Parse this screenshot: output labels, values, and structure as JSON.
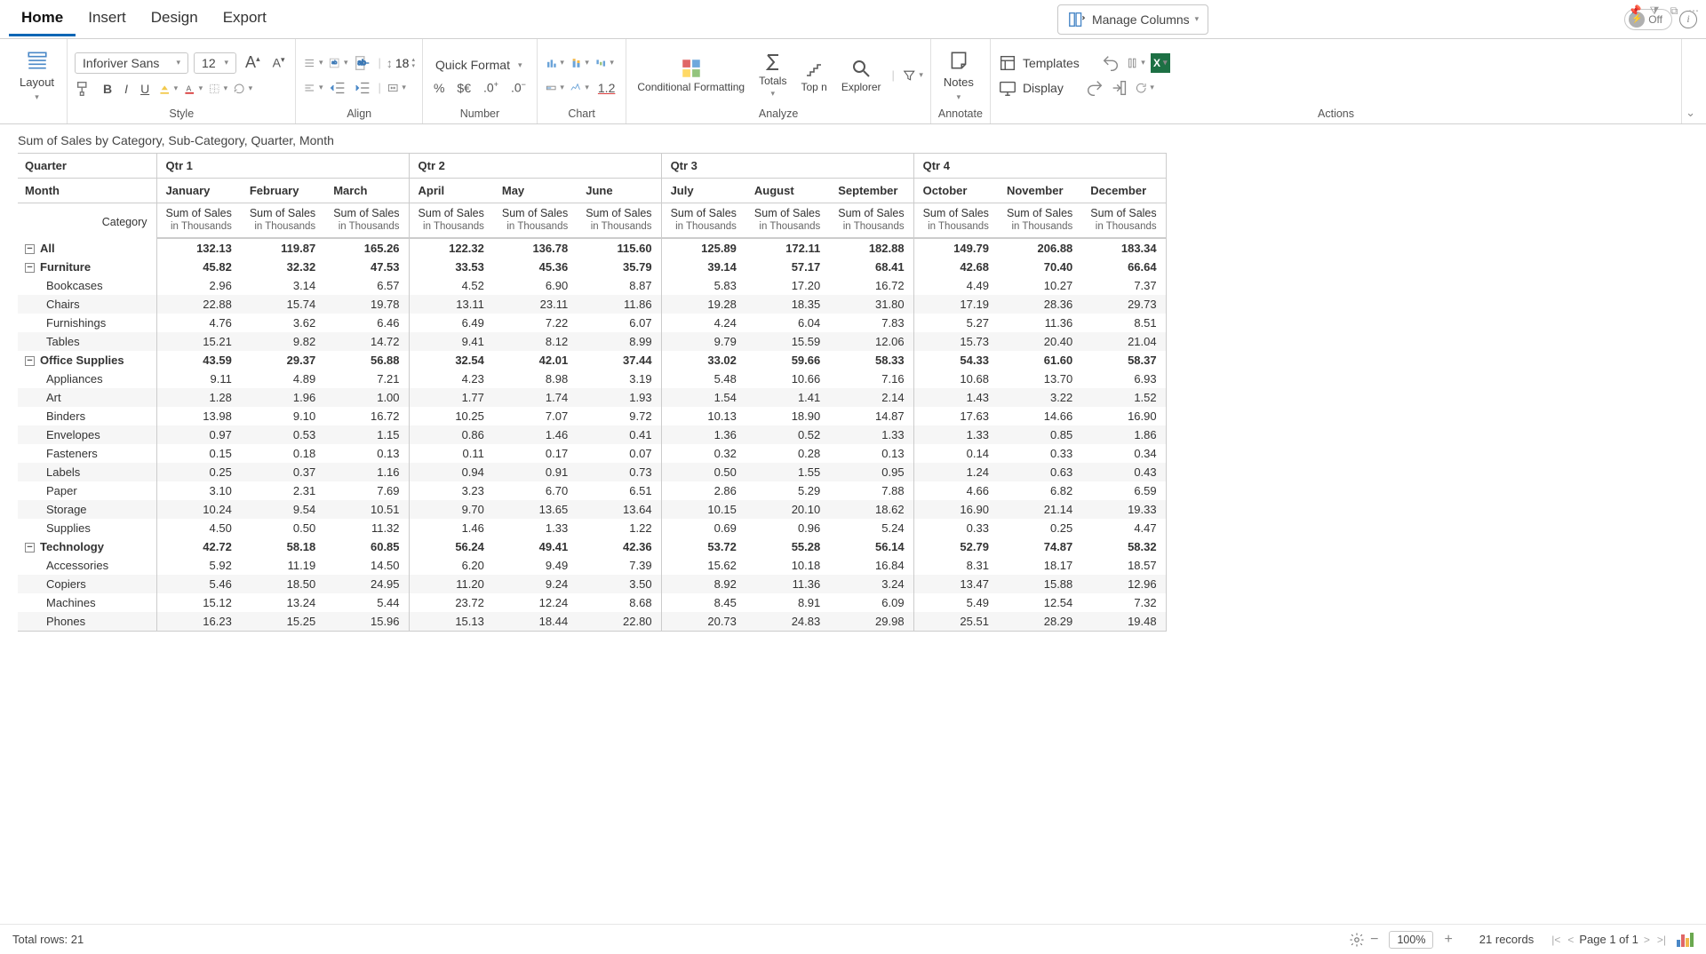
{
  "tabs": {
    "home": "Home",
    "insert": "Insert",
    "design": "Design",
    "export": "Export"
  },
  "topbar": {
    "manage_columns": "Manage Columns",
    "off": "Off"
  },
  "ribbon": {
    "layout": "Layout",
    "font_name": "Inforiver Sans",
    "font_size": "12",
    "indent_val": "18",
    "quick_format": "Quick Format",
    "cond_fmt": "Conditional Formatting",
    "totals": "Totals",
    "topn": "Top n",
    "explorer": "Explorer",
    "notes": "Notes",
    "templates": "Templates",
    "display": "Display",
    "twelve": "1.2",
    "groups": {
      "style": "Style",
      "align": "Align",
      "number": "Number",
      "chart": "Chart",
      "analyze": "Analyze",
      "annotate": "Annotate",
      "actions": "Actions"
    }
  },
  "title": "Sum of Sales by Category, Sub-Category, Quarter, Month",
  "headers": {
    "quarter": "Quarter",
    "month": "Month",
    "category": "Category",
    "quarters": [
      "Qtr 1",
      "Qtr 2",
      "Qtr 3",
      "Qtr 4"
    ],
    "months": [
      "January",
      "February",
      "March",
      "April",
      "May",
      "June",
      "July",
      "August",
      "September",
      "October",
      "November",
      "December"
    ],
    "measure": "Sum of Sales",
    "unit": "in Thousands"
  },
  "status": {
    "total_rows": "Total rows: 21",
    "zoom": "100%",
    "records": "21 records",
    "page": "Page 1 of 1"
  },
  "rows": [
    {
      "label": "All",
      "bold": true,
      "exp": true,
      "v": [
        "132.13",
        "119.87",
        "165.26",
        "122.32",
        "136.78",
        "115.60",
        "125.89",
        "172.11",
        "182.88",
        "149.79",
        "206.88",
        "183.34"
      ]
    },
    {
      "label": "Furniture",
      "bold": true,
      "exp": true,
      "v": [
        "45.82",
        "32.32",
        "47.53",
        "33.53",
        "45.36",
        "35.79",
        "39.14",
        "57.17",
        "68.41",
        "42.68",
        "70.40",
        "66.64"
      ]
    },
    {
      "label": "Bookcases",
      "indent": true,
      "v": [
        "2.96",
        "3.14",
        "6.57",
        "4.52",
        "6.90",
        "8.87",
        "5.83",
        "17.20",
        "16.72",
        "4.49",
        "10.27",
        "7.37"
      ]
    },
    {
      "label": "Chairs",
      "indent": true,
      "v": [
        "22.88",
        "15.74",
        "19.78",
        "13.11",
        "23.11",
        "11.86",
        "19.28",
        "18.35",
        "31.80",
        "17.19",
        "28.36",
        "29.73"
      ]
    },
    {
      "label": "Furnishings",
      "indent": true,
      "v": [
        "4.76",
        "3.62",
        "6.46",
        "6.49",
        "7.22",
        "6.07",
        "4.24",
        "6.04",
        "7.83",
        "5.27",
        "11.36",
        "8.51"
      ]
    },
    {
      "label": "Tables",
      "indent": true,
      "v": [
        "15.21",
        "9.82",
        "14.72",
        "9.41",
        "8.12",
        "8.99",
        "9.79",
        "15.59",
        "12.06",
        "15.73",
        "20.40",
        "21.04"
      ]
    },
    {
      "label": "Office Supplies",
      "bold": true,
      "exp": true,
      "v": [
        "43.59",
        "29.37",
        "56.88",
        "32.54",
        "42.01",
        "37.44",
        "33.02",
        "59.66",
        "58.33",
        "54.33",
        "61.60",
        "58.37"
      ]
    },
    {
      "label": "Appliances",
      "indent": true,
      "v": [
        "9.11",
        "4.89",
        "7.21",
        "4.23",
        "8.98",
        "3.19",
        "5.48",
        "10.66",
        "7.16",
        "10.68",
        "13.70",
        "6.93"
      ]
    },
    {
      "label": "Art",
      "indent": true,
      "v": [
        "1.28",
        "1.96",
        "1.00",
        "1.77",
        "1.74",
        "1.93",
        "1.54",
        "1.41",
        "2.14",
        "1.43",
        "3.22",
        "1.52"
      ]
    },
    {
      "label": "Binders",
      "indent": true,
      "v": [
        "13.98",
        "9.10",
        "16.72",
        "10.25",
        "7.07",
        "9.72",
        "10.13",
        "18.90",
        "14.87",
        "17.63",
        "14.66",
        "16.90"
      ]
    },
    {
      "label": "Envelopes",
      "indent": true,
      "v": [
        "0.97",
        "0.53",
        "1.15",
        "0.86",
        "1.46",
        "0.41",
        "1.36",
        "0.52",
        "1.33",
        "1.33",
        "0.85",
        "1.86"
      ]
    },
    {
      "label": "Fasteners",
      "indent": true,
      "v": [
        "0.15",
        "0.18",
        "0.13",
        "0.11",
        "0.17",
        "0.07",
        "0.32",
        "0.28",
        "0.13",
        "0.14",
        "0.33",
        "0.34"
      ]
    },
    {
      "label": "Labels",
      "indent": true,
      "v": [
        "0.25",
        "0.37",
        "1.16",
        "0.94",
        "0.91",
        "0.73",
        "0.50",
        "1.55",
        "0.95",
        "1.24",
        "0.63",
        "0.43"
      ]
    },
    {
      "label": "Paper",
      "indent": true,
      "v": [
        "3.10",
        "2.31",
        "7.69",
        "3.23",
        "6.70",
        "6.51",
        "2.86",
        "5.29",
        "7.88",
        "4.66",
        "6.82",
        "6.59"
      ]
    },
    {
      "label": "Storage",
      "indent": true,
      "v": [
        "10.24",
        "9.54",
        "10.51",
        "9.70",
        "13.65",
        "13.64",
        "10.15",
        "20.10",
        "18.62",
        "16.90",
        "21.14",
        "19.33"
      ]
    },
    {
      "label": "Supplies",
      "indent": true,
      "v": [
        "4.50",
        "0.50",
        "11.32",
        "1.46",
        "1.33",
        "1.22",
        "0.69",
        "0.96",
        "5.24",
        "0.33",
        "0.25",
        "4.47"
      ]
    },
    {
      "label": "Technology",
      "bold": true,
      "exp": true,
      "v": [
        "42.72",
        "58.18",
        "60.85",
        "56.24",
        "49.41",
        "42.36",
        "53.72",
        "55.28",
        "56.14",
        "52.79",
        "74.87",
        "58.32"
      ]
    },
    {
      "label": "Accessories",
      "indent": true,
      "v": [
        "5.92",
        "11.19",
        "14.50",
        "6.20",
        "9.49",
        "7.39",
        "15.62",
        "10.18",
        "16.84",
        "8.31",
        "18.17",
        "18.57"
      ]
    },
    {
      "label": "Copiers",
      "indent": true,
      "v": [
        "5.46",
        "18.50",
        "24.95",
        "11.20",
        "9.24",
        "3.50",
        "8.92",
        "11.36",
        "3.24",
        "13.47",
        "15.88",
        "12.96"
      ]
    },
    {
      "label": "Machines",
      "indent": true,
      "v": [
        "15.12",
        "13.24",
        "5.44",
        "23.72",
        "12.24",
        "8.68",
        "8.45",
        "8.91",
        "6.09",
        "5.49",
        "12.54",
        "7.32"
      ]
    },
    {
      "label": "Phones",
      "indent": true,
      "v": [
        "16.23",
        "15.25",
        "15.96",
        "15.13",
        "18.44",
        "22.80",
        "20.73",
        "24.83",
        "29.98",
        "25.51",
        "28.29",
        "19.48"
      ]
    }
  ]
}
